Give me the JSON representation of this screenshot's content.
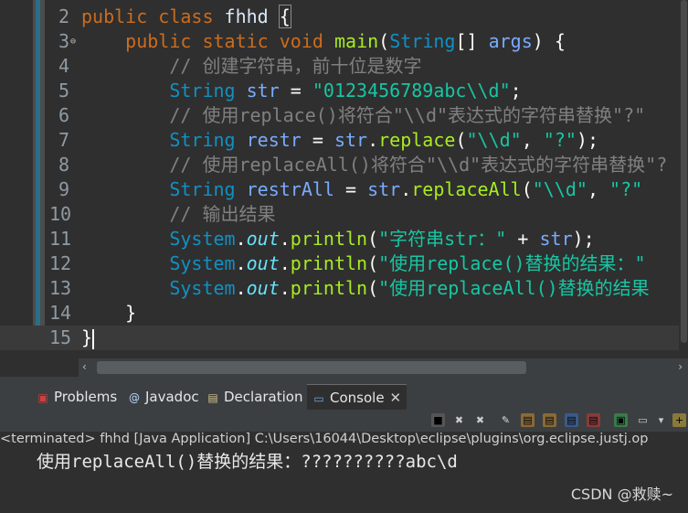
{
  "editor": {
    "lines": [
      {
        "n": "2",
        "tokens": [
          [
            "kw",
            "public "
          ],
          [
            "kw",
            "class "
          ],
          [
            "plain",
            "fhhd "
          ],
          [
            "brace",
            "{"
          ]
        ]
      },
      {
        "n": "3",
        "fold": "⊖",
        "tokens": [
          [
            "plain",
            "    "
          ],
          [
            "kw",
            "public "
          ],
          [
            "kw",
            "static "
          ],
          [
            "kw",
            "void "
          ],
          [
            "mth",
            "main"
          ],
          [
            "punc",
            "("
          ],
          [
            "cls",
            "String"
          ],
          [
            "punc",
            "[] "
          ],
          [
            "var",
            "args"
          ],
          [
            "punc",
            ") {"
          ]
        ]
      },
      {
        "n": "4",
        "tokens": [
          [
            "plain",
            "        "
          ],
          [
            "cm",
            "// 创建字符串，前十位是数字"
          ]
        ]
      },
      {
        "n": "5",
        "tokens": [
          [
            "plain",
            "        "
          ],
          [
            "cls",
            "String "
          ],
          [
            "var",
            "str "
          ],
          [
            "punc",
            "= "
          ],
          [
            "str",
            "\"0123456789abc\\\\d\""
          ],
          [
            "punc",
            ";"
          ]
        ]
      },
      {
        "n": "6",
        "tokens": [
          [
            "plain",
            "        "
          ],
          [
            "cm",
            "// 使用replace()将符合\"\\\\d\"表达式的字符串替换\"?\""
          ]
        ]
      },
      {
        "n": "7",
        "tokens": [
          [
            "plain",
            "        "
          ],
          [
            "cls",
            "String "
          ],
          [
            "var",
            "restr "
          ],
          [
            "punc",
            "= "
          ],
          [
            "var",
            "str"
          ],
          [
            "punc",
            "."
          ],
          [
            "mth",
            "replace"
          ],
          [
            "punc",
            "("
          ],
          [
            "str",
            "\"\\\\d\""
          ],
          [
            "punc",
            ", "
          ],
          [
            "str",
            "\"?\""
          ],
          [
            "punc",
            ");"
          ]
        ]
      },
      {
        "n": "8",
        "tokens": [
          [
            "plain",
            "        "
          ],
          [
            "cm",
            "// 使用replaceAll()将符合\"\\\\d\"表达式的字符串替换\"?"
          ]
        ]
      },
      {
        "n": "9",
        "tokens": [
          [
            "plain",
            "        "
          ],
          [
            "cls",
            "String "
          ],
          [
            "var",
            "restrAll "
          ],
          [
            "punc",
            "= "
          ],
          [
            "var",
            "str"
          ],
          [
            "punc",
            "."
          ],
          [
            "mth",
            "replaceAll"
          ],
          [
            "punc",
            "("
          ],
          [
            "str",
            "\"\\\\d\""
          ],
          [
            "punc",
            ", "
          ],
          [
            "str",
            "\"?\""
          ]
        ]
      },
      {
        "n": "10",
        "tokens": [
          [
            "plain",
            "        "
          ],
          [
            "cm",
            "// 输出结果"
          ]
        ]
      },
      {
        "n": "11",
        "tokens": [
          [
            "plain",
            "        "
          ],
          [
            "cls",
            "System"
          ],
          [
            "punc",
            "."
          ],
          [
            "fieldit",
            "out"
          ],
          [
            "punc",
            "."
          ],
          [
            "mth",
            "println"
          ],
          [
            "punc",
            "("
          ],
          [
            "str",
            "\"字符串str：\""
          ],
          [
            "punc",
            " + "
          ],
          [
            "var",
            "str"
          ],
          [
            "punc",
            ");"
          ]
        ]
      },
      {
        "n": "12",
        "tokens": [
          [
            "plain",
            "        "
          ],
          [
            "cls",
            "System"
          ],
          [
            "punc",
            "."
          ],
          [
            "fieldit",
            "out"
          ],
          [
            "punc",
            "."
          ],
          [
            "mth",
            "println"
          ],
          [
            "punc",
            "("
          ],
          [
            "str",
            "\"使用replace()替换的结果：\""
          ]
        ]
      },
      {
        "n": "13",
        "tokens": [
          [
            "plain",
            "        "
          ],
          [
            "cls",
            "System"
          ],
          [
            "punc",
            "."
          ],
          [
            "fieldit",
            "out"
          ],
          [
            "punc",
            "."
          ],
          [
            "mth",
            "println"
          ],
          [
            "punc",
            "("
          ],
          [
            "str",
            "\"使用replaceAll()替换的结果"
          ]
        ]
      },
      {
        "n": "14",
        "tokens": [
          [
            "plain",
            "    "
          ],
          [
            "punc",
            "}"
          ]
        ]
      },
      {
        "n": "15",
        "current": true,
        "tokens": [
          [
            "punc",
            "}"
          ],
          [
            "cursor",
            ""
          ]
        ]
      }
    ]
  },
  "panel": {
    "tabs": [
      {
        "icon": "problems-icon",
        "glyph": "▣",
        "color": "#d04040",
        "label": "Problems",
        "active": false
      },
      {
        "icon": "javadoc-icon",
        "glyph": "@",
        "color": "#b8d8ff",
        "label": "Javadoc",
        "active": false
      },
      {
        "icon": "declaration-icon",
        "glyph": "▤",
        "color": "#d0c090",
        "label": "Declaration",
        "active": false
      },
      {
        "icon": "console-icon",
        "glyph": "▭",
        "color": "#7aa6e0",
        "label": "Console",
        "active": true
      }
    ],
    "close_glyph": "✕",
    "status": "<terminated> fhhd [Java Application] C:\\Users\\16044\\Desktop\\eclipse\\plugins\\org.eclipse.justj.op",
    "output": "使用replaceAll()替换的结果：??????????abc\\d",
    "watermark": "CSDN @救赎~"
  }
}
